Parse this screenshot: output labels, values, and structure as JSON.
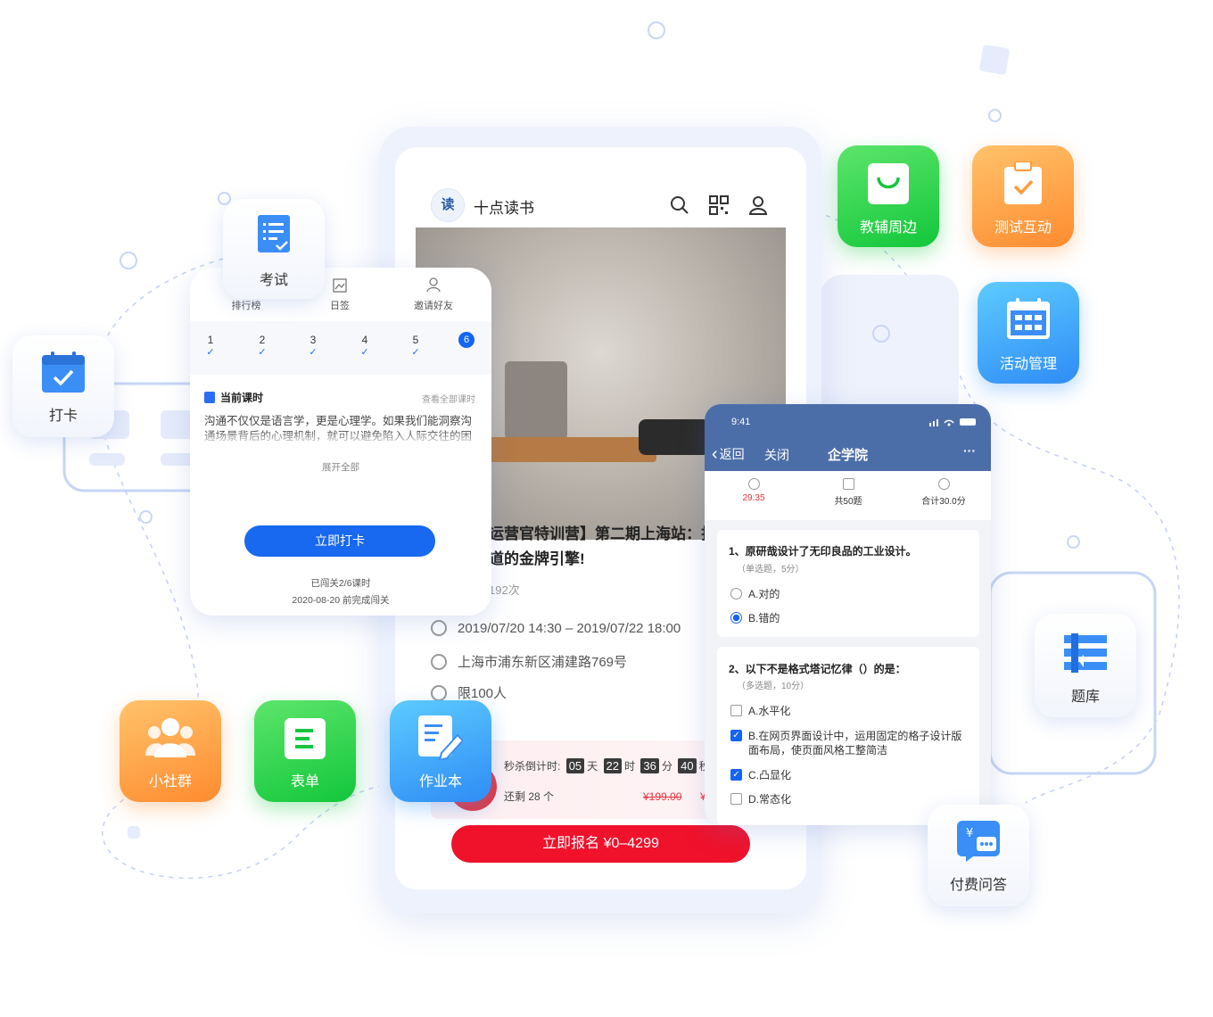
{
  "tablet": {
    "brand_logo_text": "读",
    "brand_name": "十点读书",
    "course_title_line1": "运营官特训营】第二期上海站：打",
    "course_title_line2": "道的金牌引擎!",
    "views": "192次",
    "time_range": "2019/07/20 14:30 – 2019/07/22 18:00",
    "address": "上海市浦东新区浦建路769号",
    "limit": "限100人",
    "flash_label": "秒杀倒计时:",
    "countdown": {
      "days": "05",
      "d_unit": "天",
      "hours": "22",
      "h_unit": "时",
      "minutes": "36",
      "m_unit": "分",
      "seconds": "40",
      "s_unit": "秒"
    },
    "remaining": "还剩 28 个",
    "old_price": "¥199.00",
    "price_tail": "¥",
    "cta": "立即报名 ¥0–4299"
  },
  "checkin_card": {
    "tabs": [
      "排行榜",
      "日签",
      "邀请好友"
    ],
    "steps": [
      "1",
      "2",
      "3",
      "4",
      "5"
    ],
    "active_step": "6",
    "current_label": "当前课时",
    "view_all": "查看全部课时",
    "description": "沟通不仅仅是语言学，更是心理学。如果我们能洞察沟通场景背后的心理机制，就可以避免陷入人际交往的困",
    "expand": "展开全部",
    "button": "立即打卡",
    "progress": "已闯关2/6课时",
    "deadline": "2020-08-20 前完成闯关"
  },
  "quiz_card": {
    "status_time": "9:41",
    "back": "返回",
    "close": "关闭",
    "title": "企学院",
    "more": "···",
    "stats": [
      {
        "value": "29:35",
        "color": "#e8343c"
      },
      {
        "value": "共50题",
        "color": "#333333"
      },
      {
        "value": "合计30.0分",
        "color": "#333333"
      }
    ],
    "q1": {
      "title": "1、原研哉设计了无印良品的工业设计。",
      "sub": "（单选题，5分）",
      "options": [
        "A.对的",
        "B.错的"
      ]
    },
    "q2": {
      "title": "2、以下不是格式塔记忆律（）的是：",
      "sub": "（多选题，10分）",
      "options": [
        "A.水平化",
        "B.在网页界面设计中，运用固定的格子设计版面布局，使页面风格工整简洁",
        "C.凸显化",
        "D.常态化"
      ]
    }
  },
  "tiles": {
    "exam": "考试",
    "checkin": "打卡",
    "aux": "教辅周边",
    "test": "测试互动",
    "activity": "活动管理",
    "bank": "题库",
    "community": "小社群",
    "form": "表单",
    "homework": "作业本",
    "paid_qa": "付费问答"
  },
  "colors": {
    "primary_blue": "#1868f0",
    "cta_red": "#f0112b",
    "quiz_header": "#4c6ea8"
  }
}
